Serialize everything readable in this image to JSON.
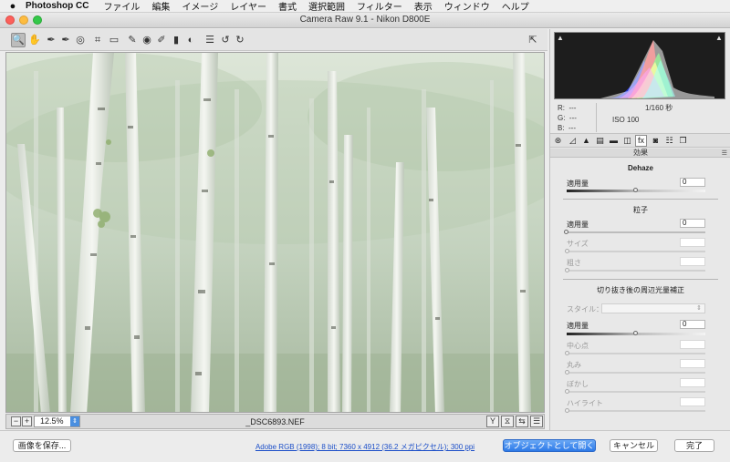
{
  "menubar": {
    "apple": "",
    "app_name": "Photoshop CC",
    "items": [
      "ファイル",
      "編集",
      "イメージ",
      "レイヤー",
      "書式",
      "選択範囲",
      "フィルター",
      "表示",
      "ウィンドウ",
      "ヘルプ"
    ]
  },
  "window": {
    "title": "Camera Raw 9.1  -  Nikon D800E"
  },
  "toolbar": {
    "tools": [
      {
        "name": "zoom-tool",
        "glyph": "🔍"
      },
      {
        "name": "hand-tool",
        "glyph": "✋"
      },
      {
        "name": "white-balance-tool",
        "glyph": "✒"
      },
      {
        "name": "color-sampler-tool",
        "glyph": "✒"
      },
      {
        "name": "targeted-adjustment-tool",
        "glyph": "◎"
      },
      {
        "name": "crop-tool",
        "glyph": "⌗"
      },
      {
        "name": "straighten-tool",
        "glyph": "▭"
      },
      {
        "name": "spot-removal-tool",
        "glyph": "✎"
      },
      {
        "name": "red-eye-tool",
        "glyph": "◉"
      },
      {
        "name": "adjustment-brush-tool",
        "glyph": "✐"
      },
      {
        "name": "graduated-filter-tool",
        "glyph": "▮"
      },
      {
        "name": "radial-filter-tool",
        "glyph": "◐"
      },
      {
        "name": "preferences-tool",
        "glyph": "☰"
      },
      {
        "name": "rotate-ccw-tool",
        "glyph": "↺"
      },
      {
        "name": "rotate-cw-tool",
        "glyph": "↻"
      }
    ],
    "fullscreen_glyph": "⇱"
  },
  "statusbar": {
    "zoom_out": "−",
    "zoom_in": "+",
    "zoom_level": "12.5%",
    "filename": "_DSC6893.NEF",
    "view_buttons": [
      "Y",
      "⧖",
      "⇆",
      "☰"
    ]
  },
  "info": {
    "r_label": "R:",
    "r_value": "---",
    "g_label": "G:",
    "g_value": "---",
    "b_label": "B:",
    "b_value": "---",
    "shutter": "1/160 秒",
    "iso": "ISO 100"
  },
  "panel_tabs": [
    "⊛",
    "◿",
    "▲",
    "▤",
    "▬",
    "◫",
    "fx",
    "◙",
    "☷",
    "❐"
  ],
  "effects": {
    "section_title": "効果",
    "dehaze": {
      "title": "Dehaze",
      "amount_label": "適用量",
      "amount_value": "0",
      "amount": 0,
      "min": -100,
      "max": 100
    },
    "grain": {
      "title": "粒子",
      "amount_label": "適用量",
      "amount_value": "0",
      "amount": 0,
      "min": 0,
      "max": 100,
      "size_label": "サイズ",
      "roughness_label": "粗さ"
    },
    "vignette": {
      "title": "切り抜き後の周辺光量補正",
      "style_label": "スタイル：",
      "amount_label": "適用量",
      "amount_value": "0",
      "amount": 0,
      "min": -100,
      "max": 100,
      "midpoint_label": "中心点",
      "roundness_label": "丸み",
      "feather_label": "ぼかし",
      "highlights_label": "ハイライト"
    }
  },
  "bottombar": {
    "save_label": "画像を保存...",
    "workflow_link": "Adobe RGB (1998); 8 bit; 7360 x 4912 (36.2 メガピクセル); 300 ppi",
    "open_object_label": "オブジェクトとして開く",
    "cancel_label": "キャンセル",
    "done_label": "完了"
  },
  "colors": {
    "primary_button": "#2d7ae8",
    "link": "#1b4ec8"
  }
}
